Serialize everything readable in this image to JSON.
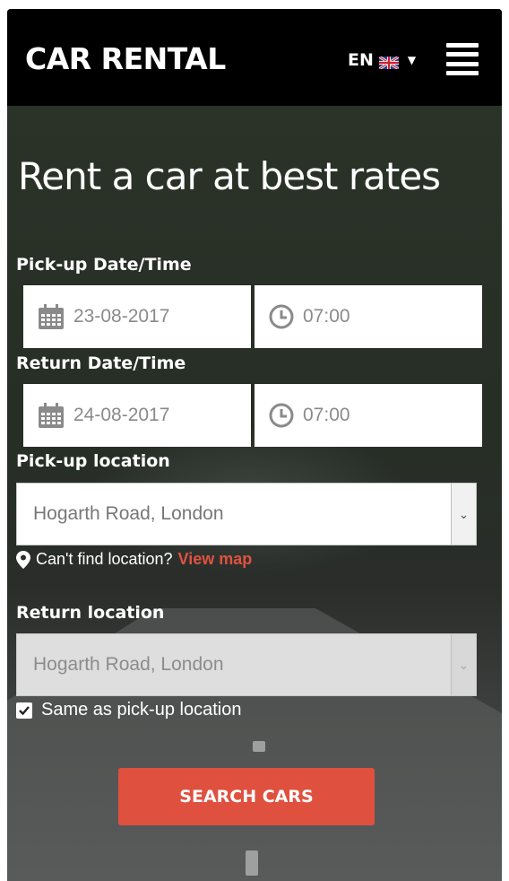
{
  "header": {
    "brand": "CAR RENTAL",
    "language": "EN",
    "language_flag": "uk-flag-icon",
    "menu_icon": "hamburger-icon"
  },
  "hero": {
    "headline": "Rent a car at best rates"
  },
  "form": {
    "pickup_label": "Pick-up Date/Time",
    "pickup_date": "23-08-2017",
    "pickup_time": "07:00",
    "return_label": "Return Date/Time",
    "return_date": "24-08-2017",
    "return_time": "07:00",
    "pickup_location_label": "Pick-up location",
    "pickup_location_value": "Hogarth Road, London",
    "hint_text": "Can't find location?",
    "hint_link": "View map",
    "return_location_label": "Return location",
    "return_location_value": "Hogarth Road, London",
    "same_location_label": "Same as pick-up location",
    "same_location_checked": true,
    "search_button": "SEARCH CARS"
  },
  "colors": {
    "accent": "#e0503f",
    "header_bg": "#000000"
  }
}
